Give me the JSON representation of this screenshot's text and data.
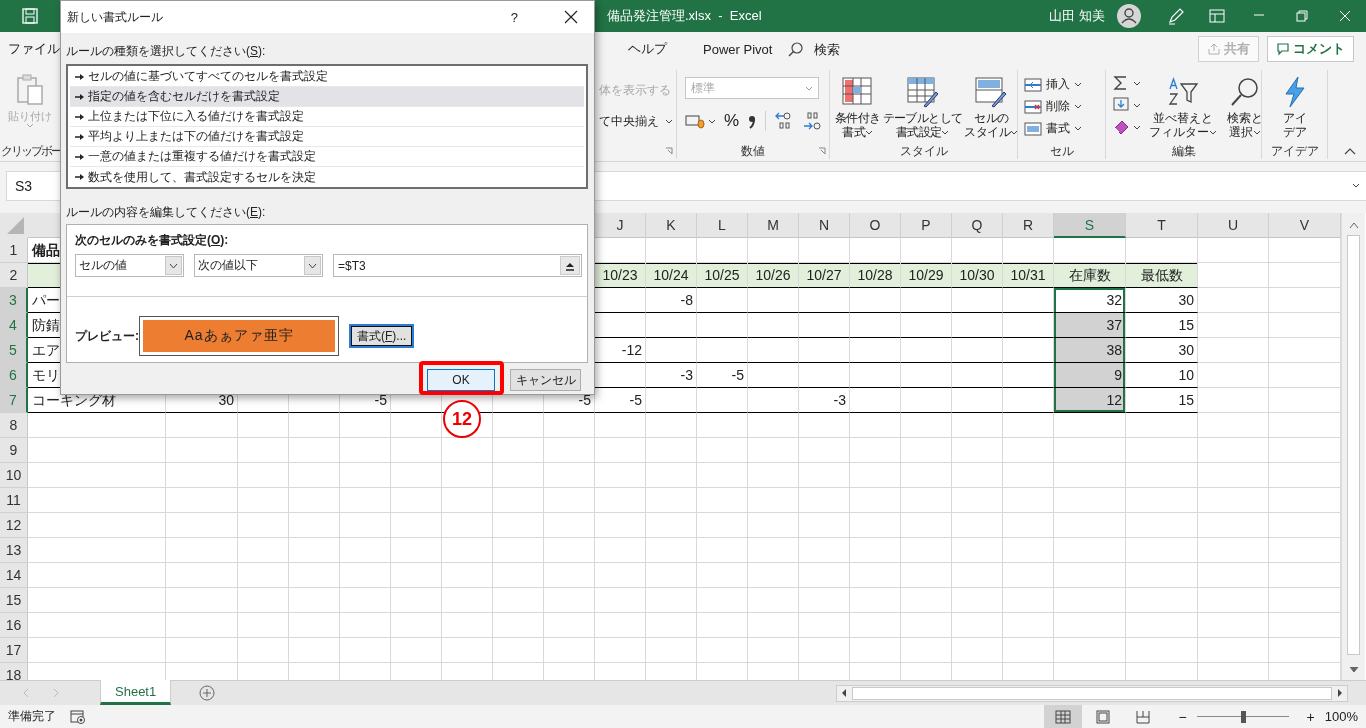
{
  "title_bar": {
    "file_title": "備品発注管理.xlsx  -  Excel",
    "user": "山田 知美"
  },
  "ribbon_tabs": [
    {
      "label": "ファイル",
      "selected": false
    },
    {
      "label": "ヘルプ",
      "selected": false
    },
    {
      "label": "Power Pivot",
      "selected": false
    }
  ],
  "search": {
    "placeholder": "検索"
  },
  "share_button": {
    "label": "共有",
    "disabled": true
  },
  "comment_button": {
    "label": "コメント"
  },
  "ribbon_groups": [
    {
      "kind": "clipboard",
      "label": "クリップボー",
      "buttons": [
        {
          "label": [
            "貼り付け"
          ],
          "disabled": true
        }
      ]
    },
    {
      "kind": "alignment",
      "buttons": [
        {
          "label": [
            "体を表示する"
          ],
          "disabled": true
        },
        {
          "label": [
            "て中央揃え"
          ],
          "disabled": false
        }
      ]
    },
    {
      "kind": "number",
      "label": "数値",
      "format": {
        "value": "標準",
        "disabled": true
      },
      "percent": "%"
    },
    {
      "kind": "styles",
      "label": "スタイル",
      "buttons": [
        {
          "label": [
            "条件付き",
            "書式"
          ]
        },
        {
          "label": [
            "テーブルとして",
            "書式設定"
          ]
        },
        {
          "label": [
            "セルの",
            "スタイル"
          ]
        }
      ]
    },
    {
      "kind": "cells",
      "label": "セル",
      "buttons": [
        {
          "label": [
            "挿入"
          ]
        },
        {
          "label": [
            "削除"
          ]
        },
        {
          "label": [
            "書式"
          ]
        }
      ]
    },
    {
      "kind": "editing",
      "label": "編集",
      "buttons": [
        {
          "label": [
            "並べ替えと",
            "フィルター"
          ]
        },
        {
          "label": [
            "検索と",
            "選択"
          ]
        }
      ]
    },
    {
      "kind": "ideas",
      "label": "アイデア",
      "buttons": [
        {
          "label": [
            "アイ",
            "デア"
          ]
        }
      ]
    }
  ],
  "name_box": {
    "value": "S3"
  },
  "sheet": {
    "columns": [
      {
        "selected": false
      },
      {},
      {},
      {},
      {},
      {},
      {},
      {},
      {},
      {
        "label": "J",
        "selected": false
      },
      {
        "label": "K",
        "selected": false
      },
      {
        "label": "L",
        "selected": false
      },
      {
        "label": "M",
        "selected": false
      },
      {
        "label": "N",
        "selected": false
      },
      {
        "label": "O",
        "selected": false
      },
      {
        "label": "P",
        "selected": false
      },
      {
        "label": "Q",
        "selected": false
      },
      {
        "label": "R",
        "selected": false
      },
      {
        "label": "S",
        "selected": true
      },
      {
        "label": "T",
        "selected": false
      },
      {
        "label": "U",
        "selected": false
      },
      {
        "label": "V",
        "selected": false
      }
    ],
    "rows": [
      {
        "label": "1",
        "selected": false,
        "kind": "title",
        "cells": [
          {
            "text": "備品",
            "selected": false
          },
          {},
          {},
          {},
          {},
          {},
          {},
          {},
          {}
        ]
      },
      {
        "label": "2",
        "selected": false,
        "kind": "header",
        "cells": [
          {
            "selected": false
          },
          {},
          {},
          {},
          {},
          {},
          {},
          {},
          {},
          {
            "text": "10/23",
            "selected": false
          },
          {
            "text": "10/24",
            "selected": false
          },
          {
            "text": "10/25",
            "selected": false
          },
          {
            "text": "10/26",
            "selected": false
          },
          {
            "text": "10/27",
            "selected": false
          },
          {
            "text": "10/28",
            "selected": false
          },
          {
            "text": "10/29",
            "selected": false
          },
          {
            "text": "10/30",
            "selected": false
          },
          {
            "text": "10/31",
            "selected": false
          },
          {
            "text": "在庫数",
            "selected": false
          },
          {
            "text": "最低数",
            "selected": false
          }
        ]
      },
      {
        "label": "3",
        "selected": true,
        "kind": "data",
        "cells": [
          {
            "text": "パー",
            "selected": false
          },
          {},
          {},
          {},
          {},
          {},
          {},
          {},
          {},
          {
            "selected": false
          },
          {
            "text": "-8",
            "selected": false
          },
          {
            "selected": false
          },
          {
            "selected": false
          },
          {
            "selected": false
          },
          {
            "selected": false
          },
          {
            "selected": false
          },
          {
            "selected": false
          },
          {
            "selected": false
          },
          {
            "text": "32",
            "selected": true,
            "active": true
          },
          {
            "text": "30",
            "selected": false
          }
        ]
      },
      {
        "label": "4",
        "selected": true,
        "kind": "data",
        "cells": [
          {
            "text": "防錆",
            "selected": false
          },
          {},
          {},
          {},
          {},
          {},
          {},
          {},
          {},
          {
            "selected": false
          },
          {
            "selected": false
          },
          {
            "selected": false
          },
          {
            "selected": false
          },
          {
            "selected": false
          },
          {
            "selected": false
          },
          {
            "selected": false
          },
          {
            "selected": false
          },
          {
            "selected": false
          },
          {
            "text": "37",
            "selected": true
          },
          {
            "text": "15",
            "selected": false
          }
        ]
      },
      {
        "label": "5",
        "selected": true,
        "kind": "data",
        "cells": [
          {
            "text": "エア",
            "selected": false
          },
          {},
          {},
          {},
          {},
          {},
          {},
          {},
          {},
          {
            "text": "-12",
            "selected": false
          },
          {
            "selected": false
          },
          {
            "selected": false
          },
          {
            "selected": false
          },
          {
            "selected": false
          },
          {
            "selected": false
          },
          {
            "selected": false
          },
          {
            "selected": false
          },
          {
            "selected": false
          },
          {
            "text": "38",
            "selected": true
          },
          {
            "text": "30",
            "selected": false
          }
        ]
      },
      {
        "label": "6",
        "selected": true,
        "kind": "data",
        "cells": [
          {
            "text": "モリ",
            "selected": false
          },
          {},
          {},
          {},
          {},
          {},
          {},
          {},
          {},
          {
            "selected": false
          },
          {
            "text": "-3",
            "selected": false
          },
          {
            "text": "-5",
            "selected": false
          },
          {
            "selected": false
          },
          {
            "selected": false
          },
          {
            "selected": false
          },
          {
            "selected": false
          },
          {
            "selected": false
          },
          {
            "selected": false
          },
          {
            "text": "9",
            "selected": true
          },
          {
            "text": "10",
            "selected": false
          }
        ]
      },
      {
        "label": "7",
        "selected": true,
        "kind": "data",
        "cells": [
          {
            "text": "コーキング材",
            "selected": false
          },
          {
            "text": "30",
            "selected": false
          },
          {
            "selected": false
          },
          {
            "selected": false
          },
          {
            "text": "-5",
            "selected": false
          },
          {
            "selected": false
          },
          {
            "selected": false
          },
          {
            "selected": false
          },
          {
            "text": "-5",
            "selected": false
          },
          {
            "text": "-5",
            "selected": false
          },
          {
            "selected": false
          },
          {
            "selected": false
          },
          {
            "selected": false
          },
          {
            "text": "-3",
            "selected": false
          },
          {
            "selected": false
          },
          {
            "selected": false
          },
          {
            "selected": false
          },
          {
            "selected": false
          },
          {
            "text": "12",
            "selected": true
          },
          {
            "text": "15",
            "selected": false
          }
        ]
      },
      {
        "label": "8",
        "selected": false
      },
      {
        "label": "9",
        "selected": false
      },
      {
        "label": "10",
        "selected": false
      },
      {
        "label": "11",
        "selected": false
      },
      {
        "label": "12",
        "selected": false
      },
      {
        "label": "13",
        "selected": false
      },
      {
        "label": "14",
        "selected": false
      },
      {
        "label": "15",
        "selected": false
      },
      {
        "label": "16",
        "selected": false
      },
      {
        "label": "17",
        "selected": false
      },
      {
        "label": "18",
        "selected": false
      }
    ]
  },
  "sheet_tabs": [
    {
      "label": "Sheet1",
      "selected": true
    }
  ],
  "status_bar": {
    "status": "準備完了",
    "views": [
      {
        "selected": true
      },
      {
        "selected": false
      },
      {
        "selected": false
      }
    ],
    "zoom_out": "−",
    "zoom_in": "+",
    "zoom": {
      "level": 0.5
    },
    "zoom_reading": "100%"
  },
  "dialog": {
    "title": "新しい書式ルール",
    "help": "?",
    "rule_type_label": [
      "ルールの種類を選択してください(",
      "S",
      "):"
    ],
    "rule_types": [
      {
        "label": "セルの値に基づいてすべてのセルを書式設定",
        "selected": false
      },
      {
        "label": "指定の値を含むセルだけを書式設定",
        "selected": true
      },
      {
        "label": "上位または下位に入る値だけを書式設定",
        "selected": false
      },
      {
        "label": "平均より上または下の値だけを書式設定",
        "selected": false
      },
      {
        "label": "一意の値または重複する値だけを書式設定",
        "selected": false
      },
      {
        "label": "数式を使用して、書式設定するセルを決定",
        "selected": false
      }
    ],
    "edit_label": [
      "ルールの内容を編集してください(",
      "E",
      "):"
    ],
    "condition_label": [
      "次のセルのみを書式設定(",
      "O",
      "):"
    ],
    "operand_dropdown": {
      "value": "セルの値"
    },
    "operator_dropdown": {
      "value": "次の値以下"
    },
    "formula_field": {
      "value": "=$T3"
    },
    "preview_label": "プレビュー:",
    "preview": {
      "text": "Aaあぁアァ亜宇"
    },
    "format_button": [
      "書式(",
      "F",
      ")..."
    ],
    "ok_button": {
      "label": "OK"
    },
    "cancel_button": {
      "label": "キャンセル"
    }
  },
  "annotation": {
    "text": "12"
  }
}
